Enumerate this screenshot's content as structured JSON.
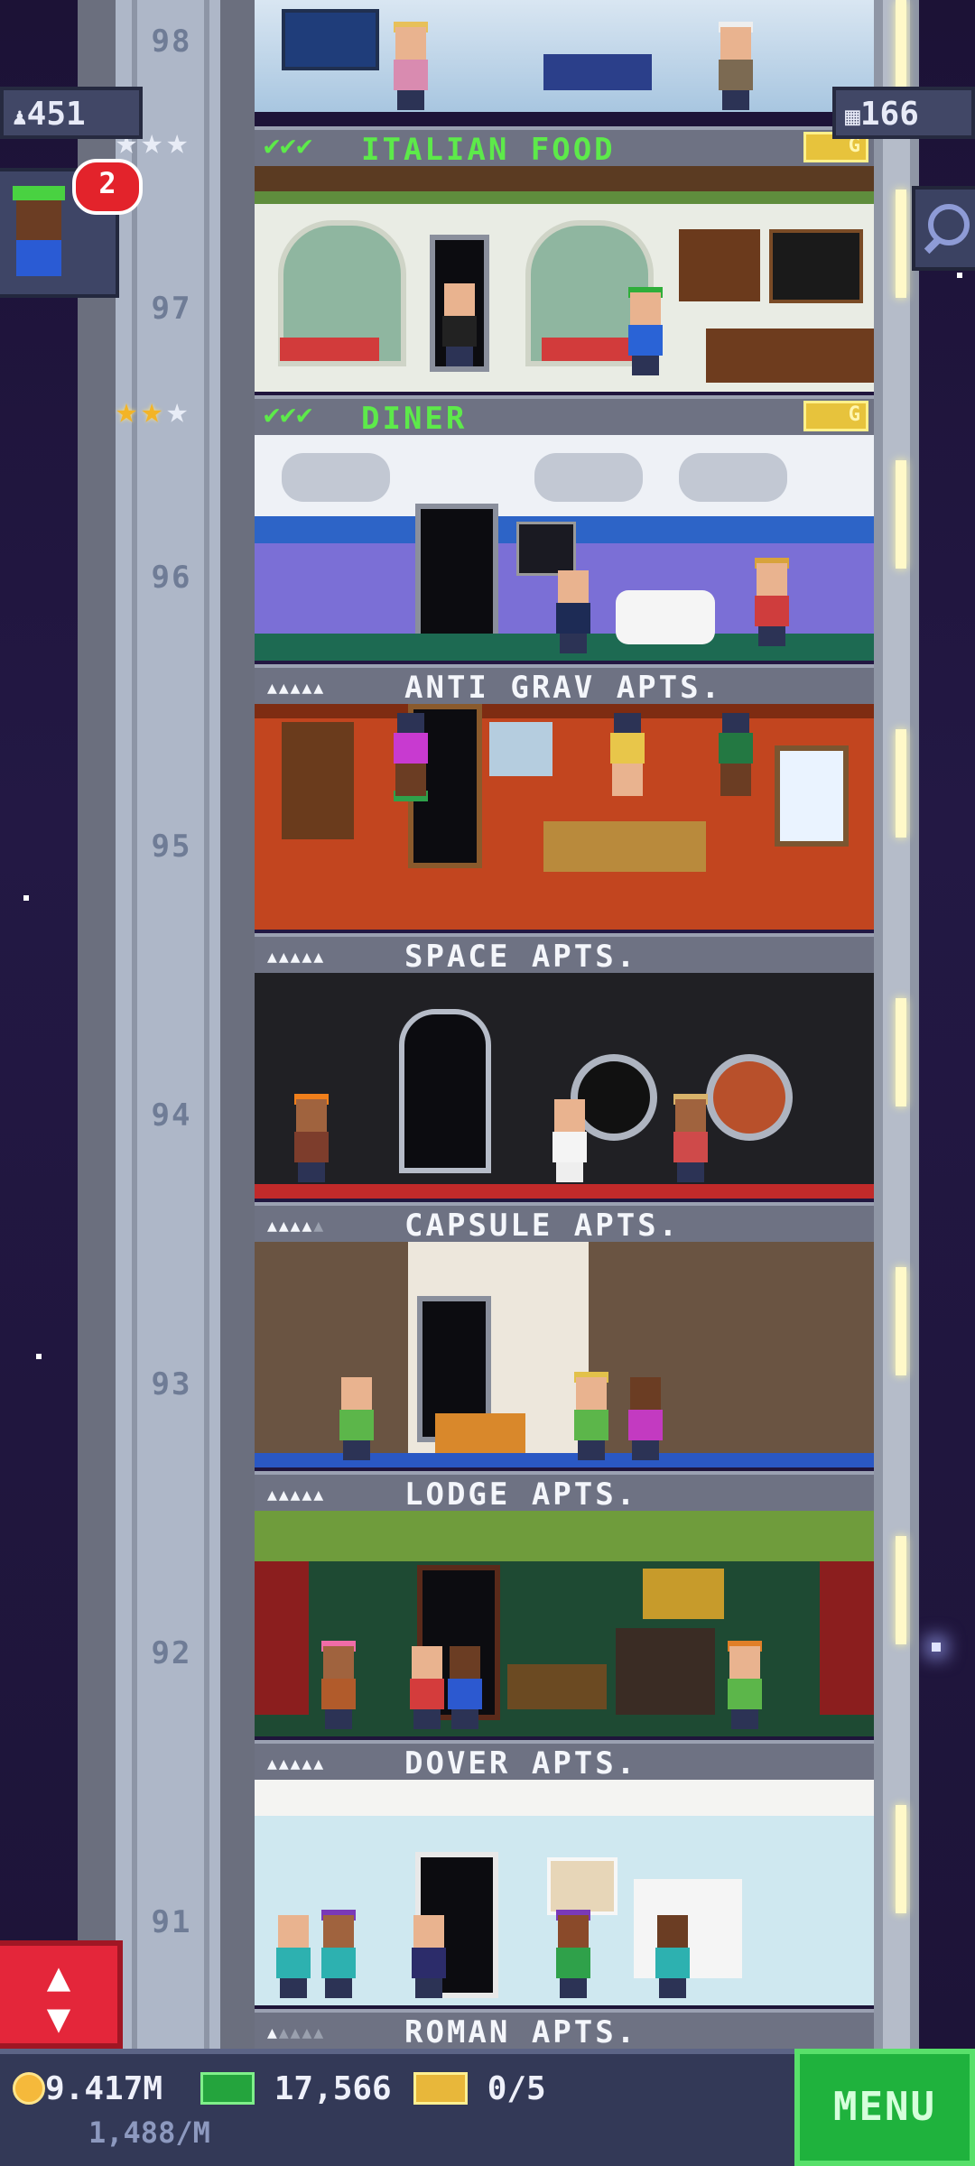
{
  "hud": {
    "population": "451",
    "floors_count": "166",
    "notification_count": "2",
    "coins": "9.417M",
    "coin_rate": "1,488/M",
    "bux": "17,566",
    "tickets": "0/5",
    "menu_label": "MENU",
    "icons": [
      "person-icon",
      "building-icon",
      "search-icon",
      "elevator-updown-icon",
      "coin-icon",
      "bux-icon",
      "ticket-icon"
    ]
  },
  "floors": [
    {
      "number": "98",
      "name": "ITALIAN FOOD",
      "type": "food",
      "stars_on": 0,
      "stars_total": 3,
      "checks": "✔✔✔"
    },
    {
      "number": "97",
      "name": "DINER",
      "type": "food",
      "stars_on": 2,
      "stars_total": 3,
      "checks": "✔✔✔"
    },
    {
      "number": "96",
      "name": "ANTI GRAV APTS.",
      "type": "residential",
      "occupancy": 5,
      "capacity": 5
    },
    {
      "number": "95",
      "name": "SPACE APTS.",
      "type": "residential",
      "occupancy": 5,
      "capacity": 5
    },
    {
      "number": "94",
      "name": "CAPSULE APTS.",
      "type": "residential",
      "occupancy": 4,
      "capacity": 5
    },
    {
      "number": "93",
      "name": "LODGE APTS.",
      "type": "residential",
      "occupancy": 5,
      "capacity": 5
    },
    {
      "number": "92",
      "name": "DOVER APTS.",
      "type": "residential",
      "occupancy": 5,
      "capacity": 5
    },
    {
      "number": "91",
      "name": "ROMAN APTS.",
      "type": "residential",
      "occupancy": 1,
      "capacity": 5
    }
  ],
  "colors": {
    "accent_green": "#5dea4a",
    "menu_green": "#1fb23d",
    "alert_red": "#e3232b",
    "coin_gold": "#f5b93b"
  }
}
